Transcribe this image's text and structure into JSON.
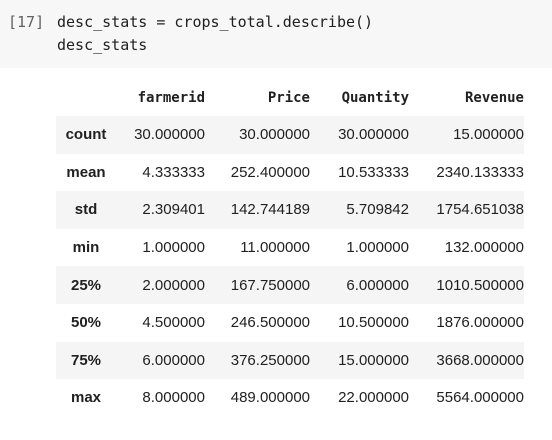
{
  "cell": {
    "execution_count": "[17]",
    "code_lines": [
      "desc_stats = crops_total.describe()",
      "desc_stats"
    ]
  },
  "table": {
    "columns": [
      "farmerid",
      "Price",
      "Quantity",
      "Revenue"
    ],
    "rows": [
      {
        "index": "count",
        "values": [
          "30.000000",
          "30.000000",
          "30.000000",
          "15.000000"
        ]
      },
      {
        "index": "mean",
        "values": [
          "4.333333",
          "252.400000",
          "10.533333",
          "2340.133333"
        ]
      },
      {
        "index": "std",
        "values": [
          "2.309401",
          "142.744189",
          "5.709842",
          "1754.651038"
        ]
      },
      {
        "index": "min",
        "values": [
          "1.000000",
          "11.000000",
          "1.000000",
          "132.000000"
        ]
      },
      {
        "index": "25%",
        "values": [
          "2.000000",
          "167.750000",
          "6.000000",
          "1010.500000"
        ]
      },
      {
        "index": "50%",
        "values": [
          "4.500000",
          "246.500000",
          "10.500000",
          "1876.000000"
        ]
      },
      {
        "index": "75%",
        "values": [
          "6.000000",
          "376.250000",
          "15.000000",
          "3668.000000"
        ]
      },
      {
        "index": "max",
        "values": [
          "8.000000",
          "489.000000",
          "22.000000",
          "5564.000000"
        ]
      }
    ]
  }
}
